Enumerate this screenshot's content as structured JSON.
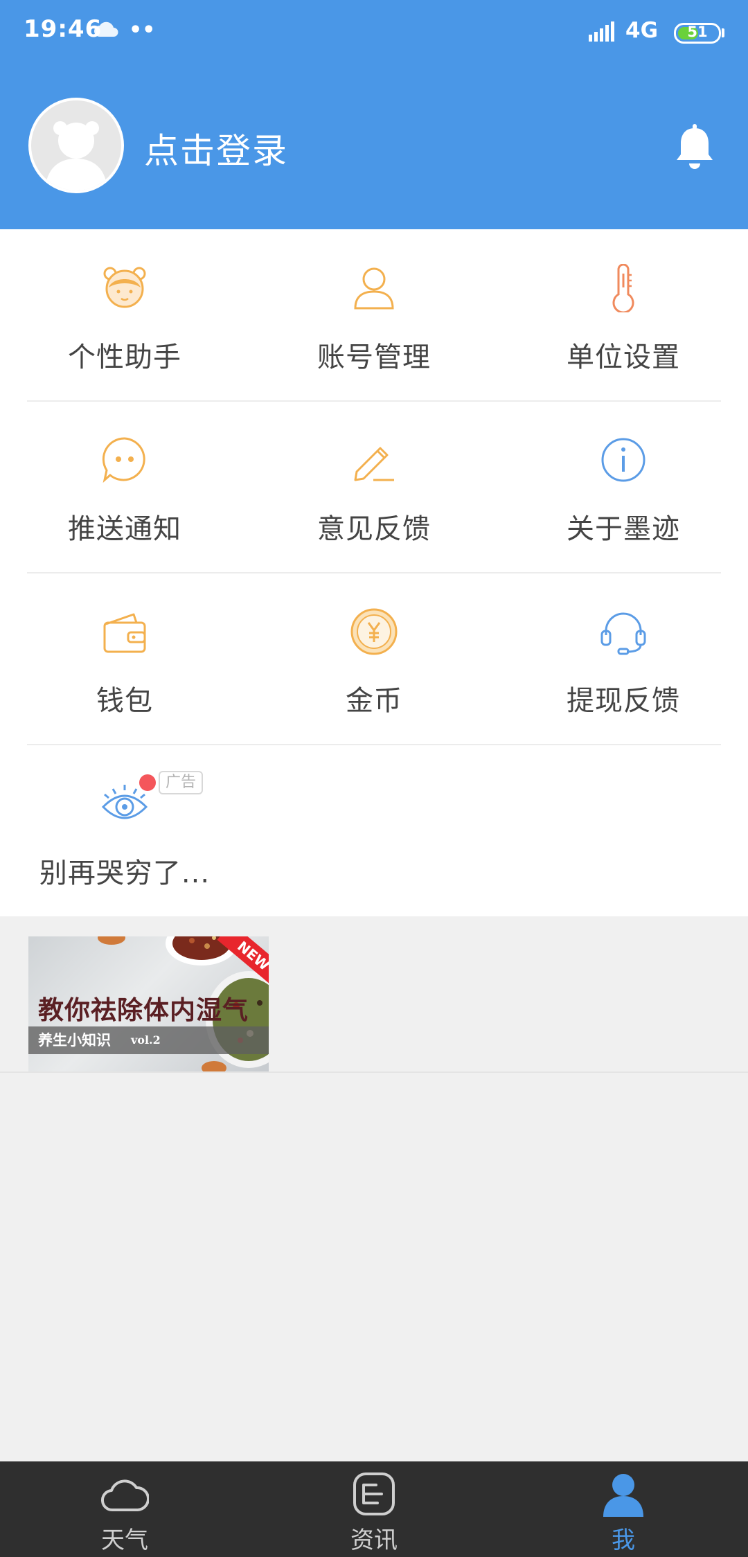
{
  "status_bar": {
    "time": "19:46",
    "network": "4G",
    "battery": "51",
    "battery_level": 0.51
  },
  "header": {
    "login_text": "点击登录"
  },
  "menu": {
    "items": [
      {
        "label": "个性助手",
        "icon": "assistant-icon"
      },
      {
        "label": "账号管理",
        "icon": "account-icon"
      },
      {
        "label": "单位设置",
        "icon": "thermometer-icon"
      },
      {
        "label": "推送通知",
        "icon": "chat-bubble-icon"
      },
      {
        "label": "意见反馈",
        "icon": "pencil-icon"
      },
      {
        "label": "关于墨迹",
        "icon": "info-icon"
      },
      {
        "label": "钱包",
        "icon": "wallet-icon"
      },
      {
        "label": "金币",
        "icon": "coin-icon"
      },
      {
        "label": "提现反馈",
        "icon": "headset-icon"
      }
    ],
    "ad_item": {
      "label": "别再哭穷了...",
      "badge": "广告",
      "icon": "eye-icon"
    }
  },
  "banner": {
    "title": "教你祛除体内湿气",
    "subtitle": "养生小知识",
    "version": "vol.2",
    "corner_tag": "NEW"
  },
  "bottom_nav": {
    "items": [
      {
        "label": "天气",
        "icon": "cloud-icon",
        "active": false
      },
      {
        "label": "资讯",
        "icon": "news-icon",
        "active": false
      },
      {
        "label": "我",
        "icon": "profile-icon",
        "active": true
      }
    ]
  },
  "colors": {
    "header_bg": "#4a97e7",
    "accent": "#4a97e7",
    "icon_orange": "#f3b04e",
    "icon_blue": "#5b9ce6",
    "nav_bg": "#2f2f2f"
  }
}
